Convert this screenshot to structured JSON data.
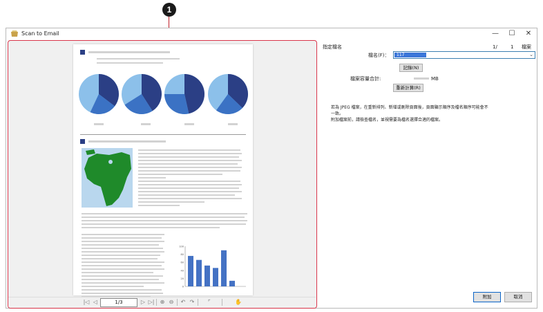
{
  "callout": {
    "number": "1"
  },
  "window": {
    "title": "Scan to Email",
    "controls": {
      "minimize": "—",
      "maximize": "☐",
      "close": "✕"
    }
  },
  "preview": {
    "page_indicator": "1/3",
    "nav": {
      "first": "|◁",
      "prev": "◁",
      "next": "▷",
      "last": "▷|",
      "zoom_in": "⊕",
      "zoom_out": "⊖",
      "rotate_left": "↶",
      "rotate_right": "↷",
      "crop": "⌜",
      "hand": "✋"
    },
    "document": {
      "pie_shares": [
        0.57,
        0.66,
        0.75,
        0.6
      ],
      "bar_chart": {
        "values": [
          76,
          66,
          52,
          46,
          90,
          14
        ],
        "ylim": [
          0,
          100
        ],
        "yticks": [
          "100",
          "80",
          "60",
          "40",
          "20",
          "0"
        ]
      }
    }
  },
  "settings": {
    "section_title": "指定檔名",
    "page_count": "1/",
    "file_count": "1",
    "file_count_unit": "檔案",
    "file_name_label": "檔名(F)：",
    "file_name_value": "117",
    "record_button": "記錄(N)",
    "size_label": "檔案容量合計:",
    "size_unit": "MB",
    "recalc_button": "重新計算(R)",
    "notice_lines": [
      "若為 JPEG 檔案，在重新排列、新增或刪除頁面後，頁面顯示順序及檔名順序可能會不",
      "一致。",
      "附加檔案前，請檢查檔名，並視需要為檔名選擇合適的檔案。"
    ]
  },
  "footer": {
    "attach_button": "附加",
    "cancel_button": "取消"
  },
  "colors": {
    "accent": "#d9354a",
    "selection": "#3a76d8",
    "pie_dark": "#2b3f85",
    "pie_mid": "#3b72c4",
    "pie_light": "#8cc0ea",
    "bar": "#4472c4",
    "map_green": "#1f8a2a"
  }
}
